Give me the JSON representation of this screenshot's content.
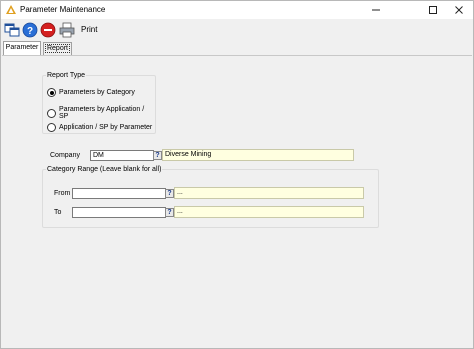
{
  "window": {
    "title": "Parameter Maintenance",
    "minimize": "—",
    "maximize": "☐",
    "close": "✕"
  },
  "toolbar": {
    "print_label": "Print"
  },
  "tabs": [
    {
      "label": "Parameter",
      "active": true
    },
    {
      "label": "Report",
      "active": false
    }
  ],
  "report_type": {
    "legend": "Report Type",
    "options": [
      {
        "label": "Parameters by Category",
        "selected": true
      },
      {
        "label": "Parameters by Application / SP",
        "selected": false
      },
      {
        "label": "Application / SP by Parameter",
        "selected": false
      }
    ]
  },
  "company": {
    "label": "Company",
    "code": "DM",
    "lookup": "?",
    "description": "Diverse Mining"
  },
  "category_range": {
    "legend": "Category Range (Leave blank for all)",
    "from": {
      "label": "From",
      "value": "",
      "lookup": "?",
      "description": "..."
    },
    "to": {
      "label": "To",
      "value": "",
      "lookup": "?",
      "description": "..."
    }
  },
  "colors": {
    "description_bg": "#ffffe0",
    "window_bg": "#f0f0f0"
  }
}
